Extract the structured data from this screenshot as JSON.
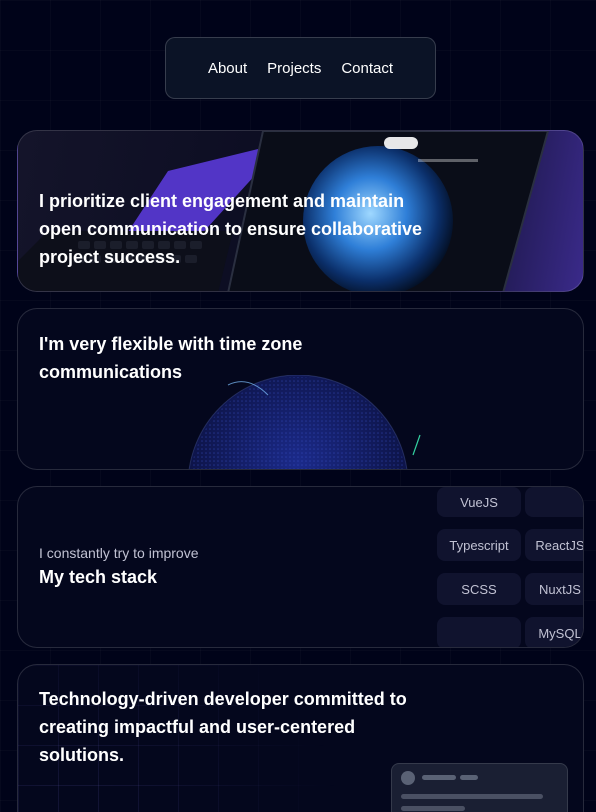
{
  "nav": {
    "items": [
      "About",
      "Projects",
      "Contact"
    ]
  },
  "cards": {
    "engagement": {
      "title_line1": "I prioritize client engagement and maintain",
      "title_line2": "open communication to ensure collaborative",
      "title_line3": "project success."
    },
    "timezone": {
      "title_line1": "I'm very flexible with time zone",
      "title_line2": "communications"
    },
    "techstack": {
      "subtitle": "I constantly try to improve",
      "title": "My tech stack",
      "chips": [
        "VueJS",
        "",
        "Typescript",
        "ReactJS",
        "SCSS",
        "NuxtJS",
        "",
        "MySQL"
      ]
    },
    "mission": {
      "title_line1": "Technology-driven developer committed to",
      "title_line2": "creating impactful and user-centered",
      "title_line3": "solutions."
    }
  },
  "colors": {
    "background": "#000319",
    "accent": "#5b3fd6",
    "chip_bg": "#10132e",
    "muted_text": "#c1c2d3"
  }
}
